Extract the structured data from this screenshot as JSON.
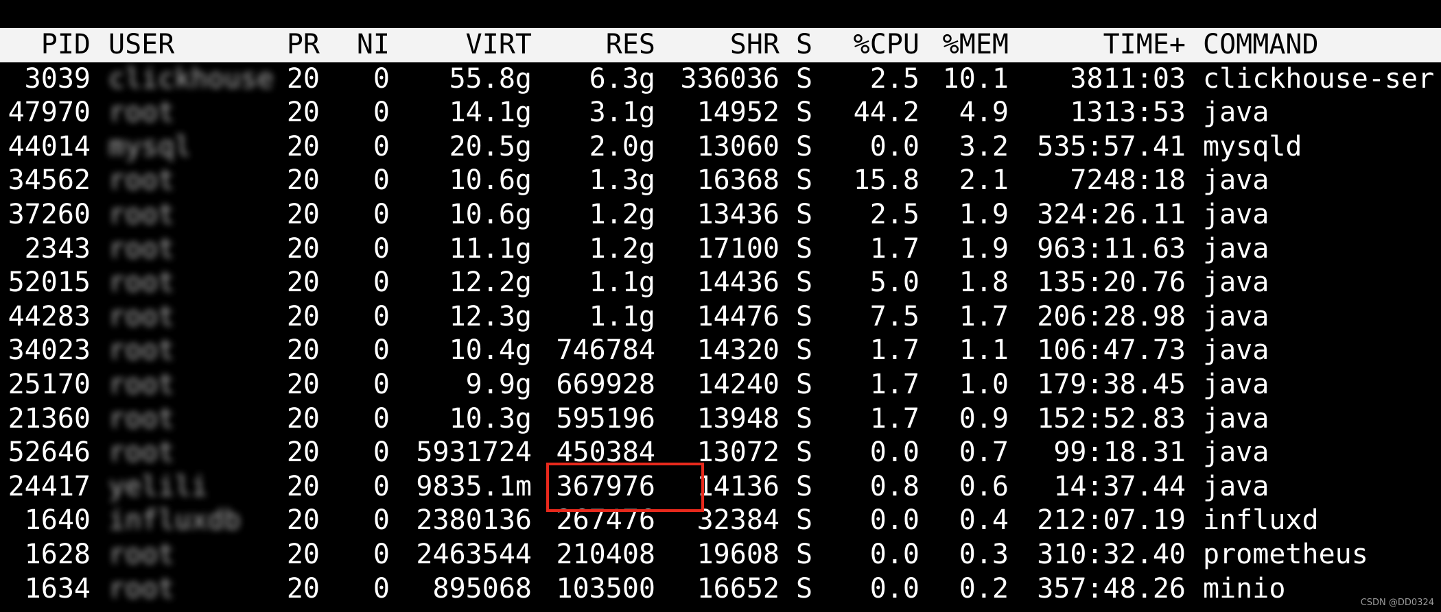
{
  "header": {
    "pid": "PID",
    "user": "USER",
    "pr": "PR",
    "ni": "NI",
    "virt": "VIRT",
    "res": "RES",
    "shr": "SHR",
    "s": "S",
    "cpu": "%CPU",
    "mem": "%MEM",
    "time": "TIME+",
    "command": "COMMAND"
  },
  "processes": [
    {
      "pid": "3039",
      "user": "clickhouse",
      "pr": "20",
      "ni": "0",
      "virt": "55.8g",
      "res": "6.3g",
      "shr": "336036",
      "s": "S",
      "cpu": "2.5",
      "mem": "10.1",
      "time": "3811:03",
      "command": "clickhouse-ser"
    },
    {
      "pid": "47970",
      "user": "root",
      "pr": "20",
      "ni": "0",
      "virt": "14.1g",
      "res": "3.1g",
      "shr": "14952",
      "s": "S",
      "cpu": "44.2",
      "mem": "4.9",
      "time": "1313:53",
      "command": "java"
    },
    {
      "pid": "44014",
      "user": "mysql",
      "pr": "20",
      "ni": "0",
      "virt": "20.5g",
      "res": "2.0g",
      "shr": "13060",
      "s": "S",
      "cpu": "0.0",
      "mem": "3.2",
      "time": "535:57.41",
      "command": "mysqld"
    },
    {
      "pid": "34562",
      "user": "root",
      "pr": "20",
      "ni": "0",
      "virt": "10.6g",
      "res": "1.3g",
      "shr": "16368",
      "s": "S",
      "cpu": "15.8",
      "mem": "2.1",
      "time": "7248:18",
      "command": "java"
    },
    {
      "pid": "37260",
      "user": "root",
      "pr": "20",
      "ni": "0",
      "virt": "10.6g",
      "res": "1.2g",
      "shr": "13436",
      "s": "S",
      "cpu": "2.5",
      "mem": "1.9",
      "time": "324:26.11",
      "command": "java"
    },
    {
      "pid": "2343",
      "user": "root",
      "pr": "20",
      "ni": "0",
      "virt": "11.1g",
      "res": "1.2g",
      "shr": "17100",
      "s": "S",
      "cpu": "1.7",
      "mem": "1.9",
      "time": "963:11.63",
      "command": "java"
    },
    {
      "pid": "52015",
      "user": "root",
      "pr": "20",
      "ni": "0",
      "virt": "12.2g",
      "res": "1.1g",
      "shr": "14436",
      "s": "S",
      "cpu": "5.0",
      "mem": "1.8",
      "time": "135:20.76",
      "command": "java"
    },
    {
      "pid": "44283",
      "user": "root",
      "pr": "20",
      "ni": "0",
      "virt": "12.3g",
      "res": "1.1g",
      "shr": "14476",
      "s": "S",
      "cpu": "7.5",
      "mem": "1.7",
      "time": "206:28.98",
      "command": "java"
    },
    {
      "pid": "34023",
      "user": "root",
      "pr": "20",
      "ni": "0",
      "virt": "10.4g",
      "res": "746784",
      "shr": "14320",
      "s": "S",
      "cpu": "1.7",
      "mem": "1.1",
      "time": "106:47.73",
      "command": "java"
    },
    {
      "pid": "25170",
      "user": "root",
      "pr": "20",
      "ni": "0",
      "virt": "9.9g",
      "res": "669928",
      "shr": "14240",
      "s": "S",
      "cpu": "1.7",
      "mem": "1.0",
      "time": "179:38.45",
      "command": "java"
    },
    {
      "pid": "21360",
      "user": "root",
      "pr": "20",
      "ni": "0",
      "virt": "10.3g",
      "res": "595196",
      "shr": "13948",
      "s": "S",
      "cpu": "1.7",
      "mem": "0.9",
      "time": "152:52.83",
      "command": "java"
    },
    {
      "pid": "52646",
      "user": "root",
      "pr": "20",
      "ni": "0",
      "virt": "5931724",
      "res": "450384",
      "shr": "13072",
      "s": "S",
      "cpu": "0.0",
      "mem": "0.7",
      "time": "99:18.31",
      "command": "java"
    },
    {
      "pid": "24417",
      "user": "yelili",
      "pr": "20",
      "ni": "0",
      "virt": "9835.1m",
      "res": "367976",
      "shr": "14136",
      "s": "S",
      "cpu": "0.8",
      "mem": "0.6",
      "time": "14:37.44",
      "command": "java"
    },
    {
      "pid": "1640",
      "user": "influxdb",
      "pr": "20",
      "ni": "0",
      "virt": "2380136",
      "res": "267476",
      "shr": "32384",
      "s": "S",
      "cpu": "0.0",
      "mem": "0.4",
      "time": "212:07.19",
      "command": "influxd"
    },
    {
      "pid": "1628",
      "user": "root",
      "pr": "20",
      "ni": "0",
      "virt": "2463544",
      "res": "210408",
      "shr": "19608",
      "s": "S",
      "cpu": "0.0",
      "mem": "0.3",
      "time": "310:32.40",
      "command": "prometheus"
    },
    {
      "pid": "1634",
      "user": "root",
      "pr": "20",
      "ni": "0",
      "virt": "895068",
      "res": "103500",
      "shr": "16652",
      "s": "S",
      "cpu": "0.0",
      "mem": "0.2",
      "time": "357:48.26",
      "command": "minio"
    }
  ],
  "watermark": "CSDN @DD0324",
  "colors": {
    "background": "#000000",
    "header_background": "#f3f3f3",
    "text": "#ffffff",
    "highlight": "#e8291c"
  }
}
